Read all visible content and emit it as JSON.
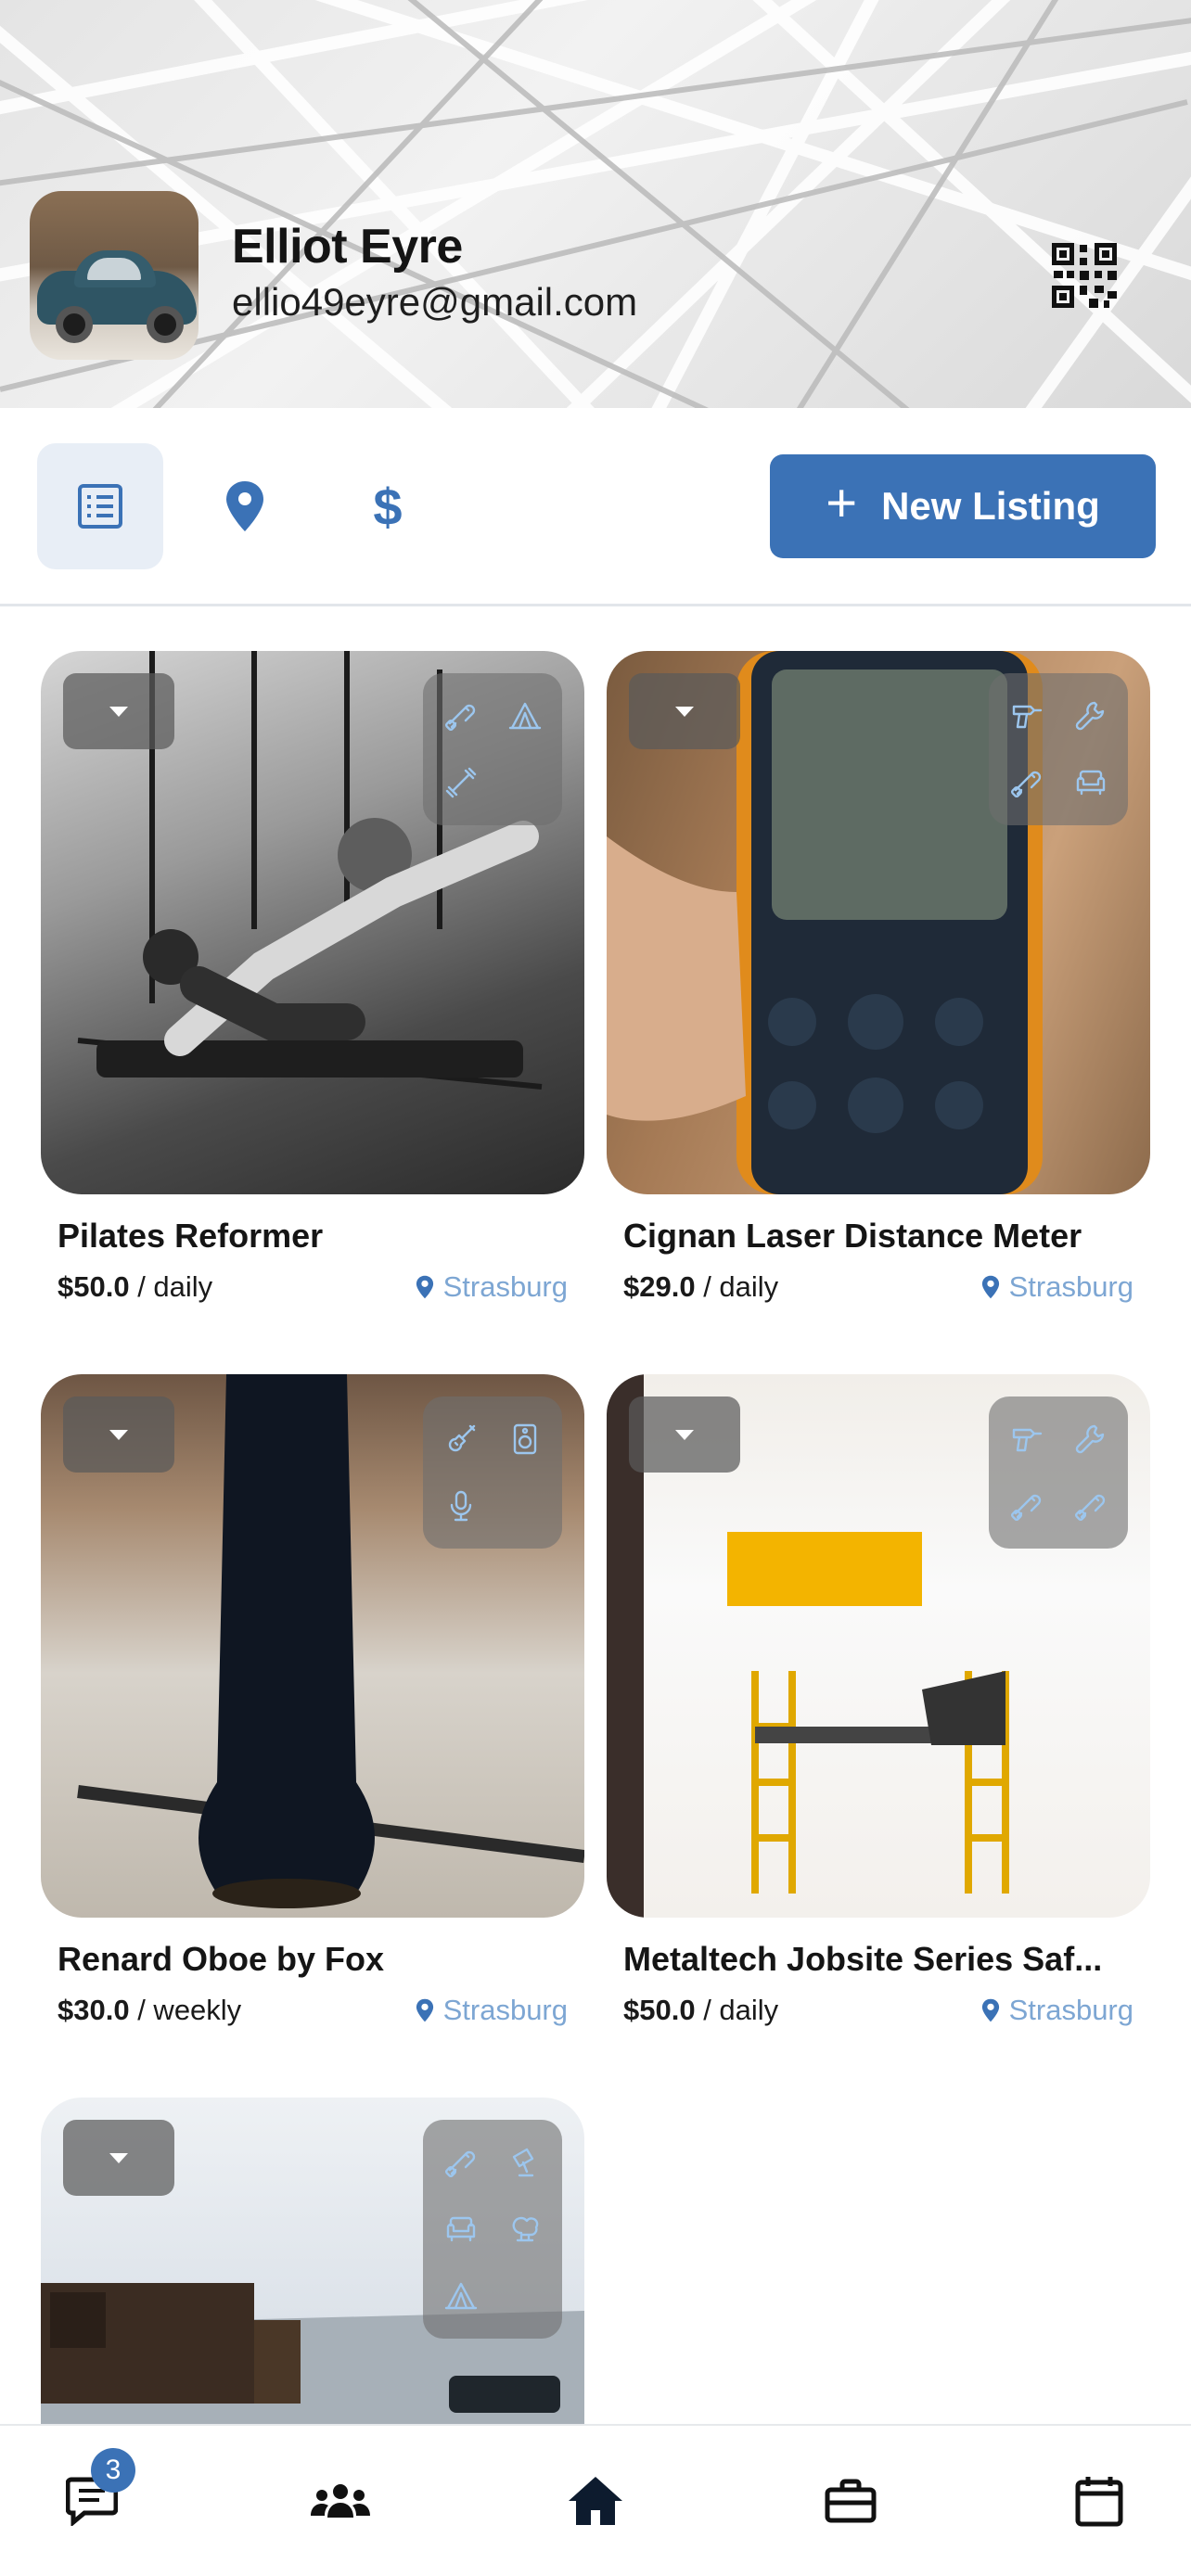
{
  "profile": {
    "name": "Elliot Eyre",
    "email": "ellio49eyre@gmail.com"
  },
  "toolbar": {
    "tabs": [
      {
        "icon": "list-icon",
        "active": true
      },
      {
        "icon": "map-pin-icon",
        "active": false
      },
      {
        "icon": "dollar-icon",
        "active": false
      }
    ],
    "new_listing_label": "New Listing"
  },
  "listings": [
    {
      "title": "Pilates Reformer",
      "price": "$50.0",
      "period": "/ daily",
      "location": "Strasburg",
      "category_icons": [
        "paint-roller-icon",
        "tent-icon",
        "dumbbell-icon"
      ]
    },
    {
      "title": "Cignan Laser Distance Meter",
      "price": "$29.0",
      "period": "/ daily",
      "location": "Strasburg",
      "category_icons": [
        "drill-icon",
        "wrench-icon",
        "paint-roller-icon",
        "couch-icon"
      ]
    },
    {
      "title": "Renard Oboe by Fox",
      "price": "$30.0",
      "period": "/ weekly",
      "location": "Strasburg",
      "category_icons": [
        "guitar-icon",
        "speaker-icon",
        "microphone-icon"
      ]
    },
    {
      "title": "Metaltech Jobsite Series Saf...",
      "price": "$50.0",
      "period": "/ daily",
      "location": "Strasburg",
      "category_icons": [
        "drill-icon",
        "wrench-icon",
        "paint-roller-icon",
        "paint-roller-icon"
      ]
    },
    {
      "title": "",
      "price": "",
      "period": "",
      "location": "",
      "category_icons": [
        "paint-roller-icon",
        "lamp-icon",
        "couch-icon",
        "tree-icon",
        "tent-icon"
      ]
    }
  ],
  "bottom_nav": {
    "items": [
      "chat-icon",
      "users-icon",
      "home-icon",
      "briefcase-icon",
      "calendar-icon"
    ],
    "chat_badge": "3",
    "active": "home-icon"
  },
  "colors": {
    "accent": "#3b72b6",
    "location": "#7da6d3",
    "category_icon": "#9cc6ee"
  }
}
